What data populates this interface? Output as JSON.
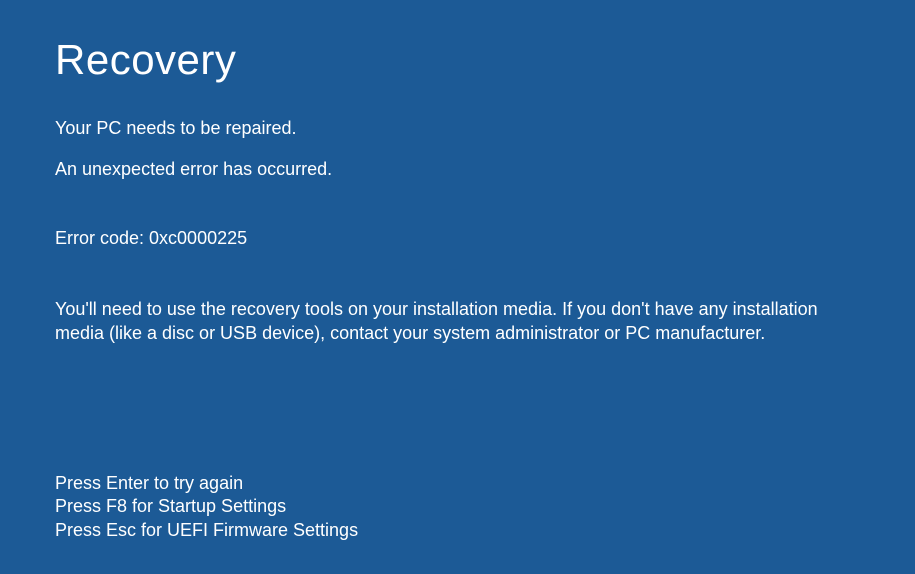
{
  "title": "Recovery",
  "subtitle": "Your PC needs to be repaired.",
  "error_message": "An unexpected error has occurred.",
  "error_code": "Error code: 0xc0000225",
  "instructions": "You'll need to use the recovery tools on your installation media. If you don't have any installation media (like a disc or USB device), contact your system administrator or PC manufacturer.",
  "keypress": {
    "enter": "Press Enter to try again",
    "f8": "Press F8 for Startup Settings",
    "esc": "Press Esc for UEFI Firmware Settings"
  }
}
